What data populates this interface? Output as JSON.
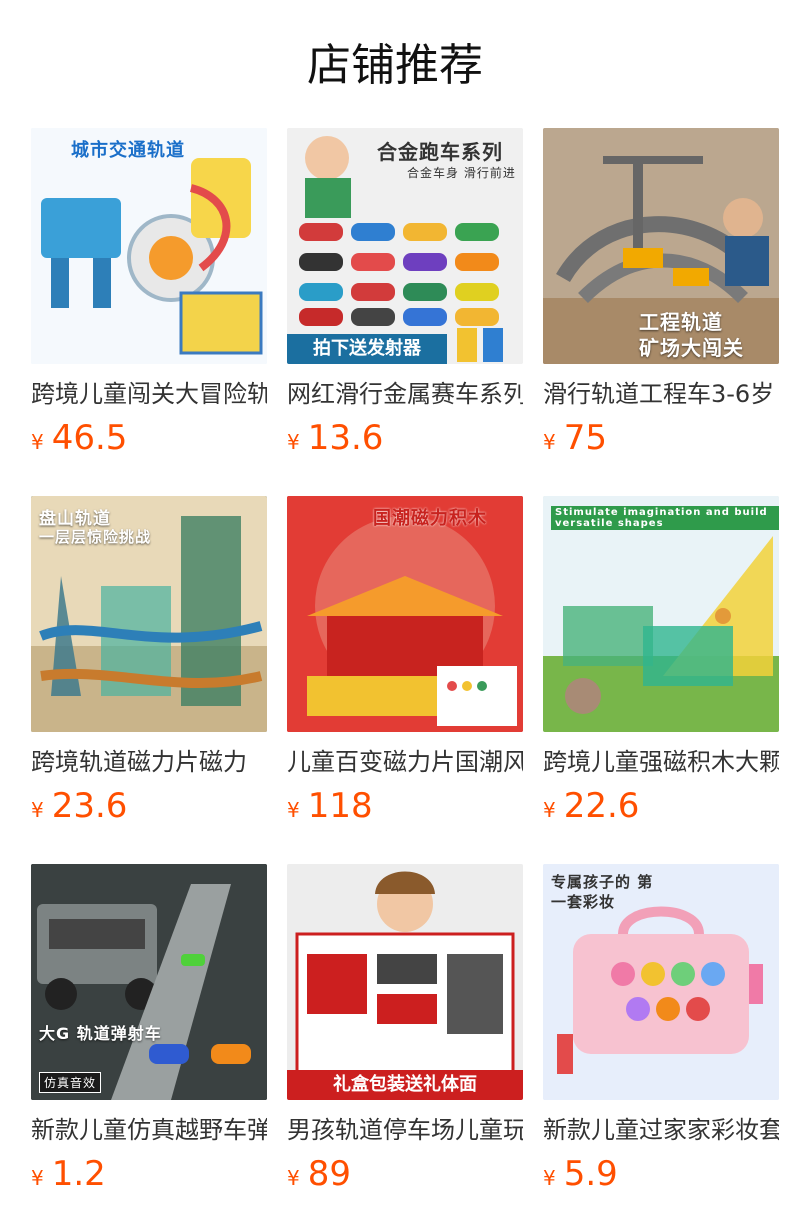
{
  "page": {
    "title": "店铺推荐"
  },
  "currency": "¥",
  "products": [
    {
      "name": "跨境儿童闯关大冒险轨道",
      "price": "46.5",
      "image_text": "城市交通轨道",
      "bg": "#e8f2fa",
      "accent": "#1a6fc9"
    },
    {
      "name": "网红滑行金属赛车系列",
      "price": "13.6",
      "image_text": "合金跑车系列",
      "sub_text": "合金车身 滑行前进",
      "badge_text": "拍下送发射器",
      "bg": "#f4f4f4",
      "accent": "#d23b3b"
    },
    {
      "name": "滑行轨道工程车3-6岁",
      "price": "75",
      "image_text": "工程轨道",
      "sub_text": "矿场大闯关",
      "bg": "#c9b8a2",
      "accent": "#f2a900"
    },
    {
      "name": "跨境轨道磁力片磁力",
      "price": "23.6",
      "image_text": "盘山轨道",
      "sub_text": "一层层惊险挑战",
      "bg": "#2f5b6b",
      "accent": "#3fd3b2"
    },
    {
      "name": "儿童百变磁力片国潮风",
      "price": "118",
      "image_text": "国潮磁力积木",
      "bg": "#e03a33",
      "accent": "#f5c342"
    },
    {
      "name": "跨境儿童强磁积木大颗粒",
      "price": "22.6",
      "image_text": "Stimulate imagination and build versatile shapes",
      "bg": "#dfeee0",
      "accent": "#3aa34a"
    },
    {
      "name": "新款儿童仿真越野车弹射",
      "price": "1.2",
      "image_text": "大G 轨道弹射车",
      "badge_text": "仿真音效",
      "bg": "#2b2f2f",
      "accent": "#9aa0a0"
    },
    {
      "name": "男孩轨道停车场儿童玩具",
      "price": "89",
      "image_text": "礼盒包装送礼体面",
      "bg": "#f2f2f2",
      "accent": "#cc1f1f"
    },
    {
      "name": "新款儿童过家家彩妆套装",
      "price": "5.9",
      "image_text": "专属孩子的 第一套彩妆",
      "bg": "#e7eefb",
      "accent": "#f07aa7"
    }
  ]
}
